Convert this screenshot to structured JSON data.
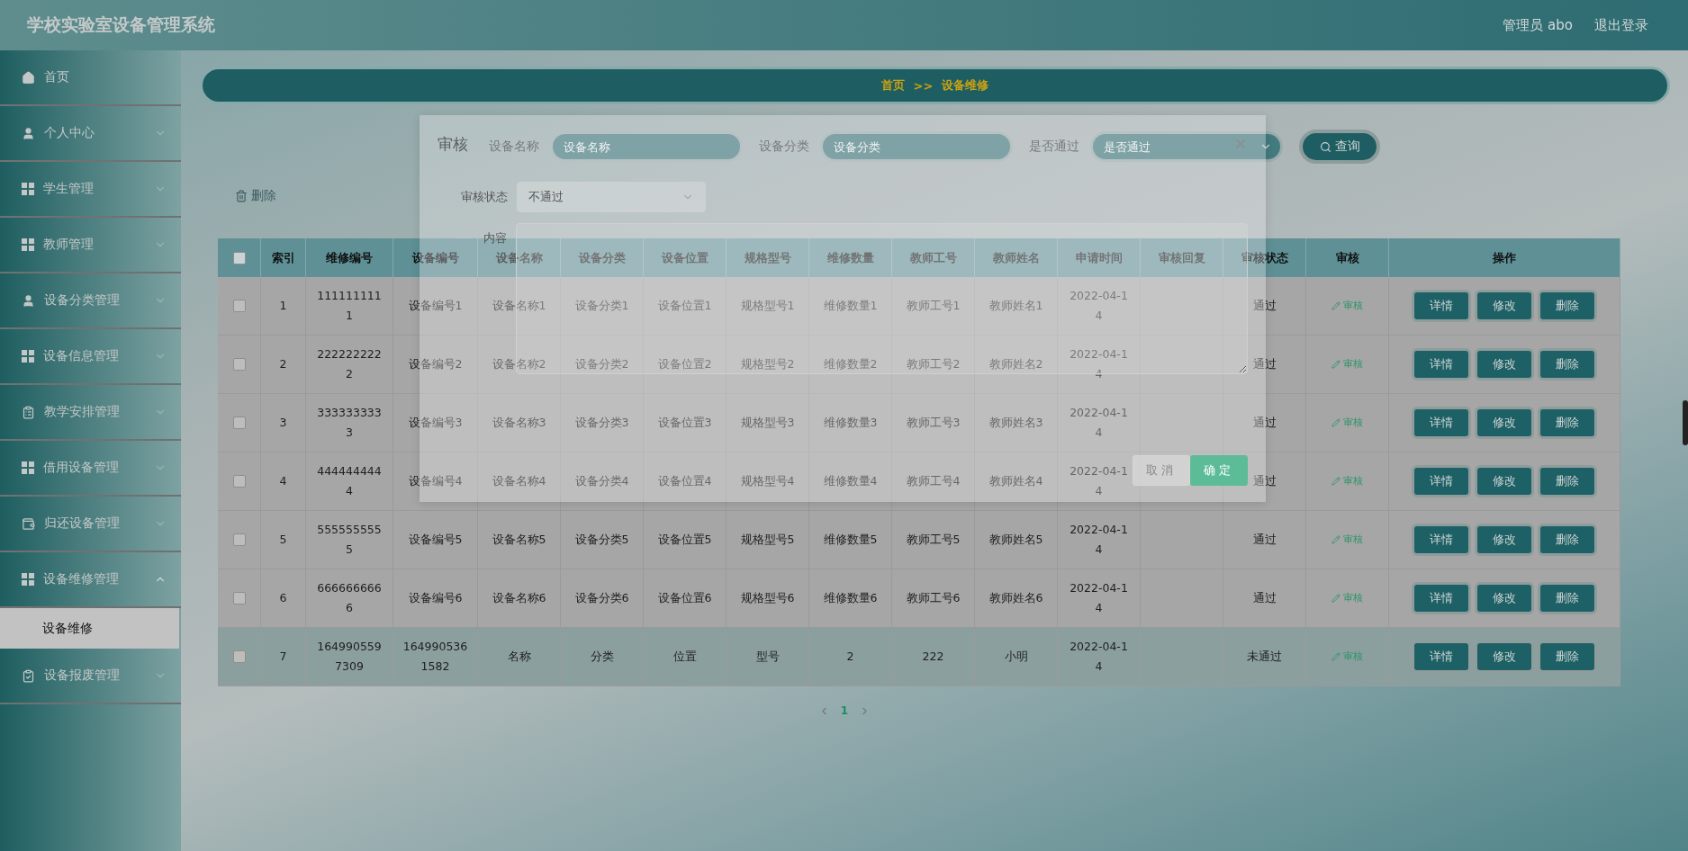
{
  "header": {
    "title": "学校实验室设备管理系统",
    "user": "管理员 abo",
    "logout": "退出登录"
  },
  "sidebar": {
    "items": [
      {
        "label": "首页",
        "kind": "home",
        "expanded": false
      },
      {
        "label": "个人中心",
        "kind": "user",
        "expanded": false
      },
      {
        "label": "学生管理",
        "kind": "grid",
        "expanded": false
      },
      {
        "label": "教师管理",
        "kind": "grid",
        "expanded": false
      },
      {
        "label": "设备分类管理",
        "kind": "user",
        "expanded": false
      },
      {
        "label": "设备信息管理",
        "kind": "grid",
        "expanded": false
      },
      {
        "label": "教学安排管理",
        "kind": "clipboard",
        "expanded": false
      },
      {
        "label": "借用设备管理",
        "kind": "grid",
        "expanded": false
      },
      {
        "label": "归还设备管理",
        "kind": "wallet",
        "expanded": false
      },
      {
        "label": "设备维修管理",
        "kind": "grid",
        "expanded": true,
        "children": [
          {
            "label": "设备维修",
            "selected": true
          }
        ]
      },
      {
        "label": "设备报废管理",
        "kind": "check",
        "expanded": false
      }
    ]
  },
  "breadcrumb": [
    "首页",
    ">>",
    "设备维修"
  ],
  "search": {
    "fields": [
      {
        "label": "设备名称",
        "kind": "input",
        "placeholder": "设备名称"
      },
      {
        "label": "设备分类",
        "kind": "input",
        "placeholder": "设备分类"
      },
      {
        "label": "是否通过",
        "kind": "select",
        "placeholder": "是否通过"
      }
    ],
    "button": "查询"
  },
  "toolbar": {
    "delete": "删除"
  },
  "table": {
    "select_all_checked": false,
    "columns": [
      "索引",
      "维修编号",
      "设备编号",
      "设备名称",
      "设备分类",
      "设备位置",
      "规格型号",
      "维修数量",
      "教师工号",
      "教师姓名",
      "申请时间",
      "审核回复",
      "审核状态",
      "审核",
      "操作"
    ],
    "rows": [
      {
        "checked": false,
        "highlighted": false,
        "index": "1",
        "repair_no": "1111111111",
        "device_no": "设备编号1",
        "name": "设备名称1",
        "category": "设备分类1",
        "location": "设备位置1",
        "model": "规格型号1",
        "quantity": "维修数量1",
        "teacher_no": "教师工号1",
        "teacher_name": "教师姓名1",
        "applied_at": "2022-04-14",
        "status": "通过",
        "audit": "审核",
        "actions": [
          "详情",
          "修改",
          "删除"
        ]
      },
      {
        "checked": false,
        "highlighted": false,
        "index": "2",
        "repair_no": "2222222222",
        "device_no": "设备编号2",
        "name": "设备名称2",
        "category": "设备分类2",
        "location": "设备位置2",
        "model": "规格型号2",
        "quantity": "维修数量2",
        "teacher_no": "教师工号2",
        "teacher_name": "教师姓名2",
        "applied_at": "2022-04-14",
        "status": "通过",
        "audit": "审核",
        "actions": [
          "详情",
          "修改",
          "删除"
        ]
      },
      {
        "checked": false,
        "highlighted": false,
        "index": "3",
        "repair_no": "3333333333",
        "device_no": "设备编号3",
        "name": "设备名称3",
        "category": "设备分类3",
        "location": "设备位置3",
        "model": "规格型号3",
        "quantity": "维修数量3",
        "teacher_no": "教师工号3",
        "teacher_name": "教师姓名3",
        "applied_at": "2022-04-14",
        "status": "通过",
        "audit": "审核",
        "actions": [
          "详情",
          "修改",
          "删除"
        ]
      },
      {
        "checked": false,
        "highlighted": false,
        "index": "4",
        "repair_no": "4444444444",
        "device_no": "设备编号4",
        "name": "设备名称4",
        "category": "设备分类4",
        "location": "设备位置4",
        "model": "规格型号4",
        "quantity": "维修数量4",
        "teacher_no": "教师工号4",
        "teacher_name": "教师姓名4",
        "applied_at": "2022-04-14",
        "status": "通过",
        "audit": "审核",
        "actions": [
          "详情",
          "修改",
          "删除"
        ]
      },
      {
        "checked": false,
        "highlighted": false,
        "index": "5",
        "repair_no": "5555555555",
        "device_no": "设备编号5",
        "name": "设备名称5",
        "category": "设备分类5",
        "location": "设备位置5",
        "model": "规格型号5",
        "quantity": "维修数量5",
        "teacher_no": "教师工号5",
        "teacher_name": "教师姓名5",
        "applied_at": "2022-04-14",
        "status": "通过",
        "audit": "审核",
        "actions": [
          "详情",
          "修改",
          "删除"
        ]
      },
      {
        "checked": false,
        "highlighted": false,
        "index": "6",
        "repair_no": "6666666666",
        "device_no": "设备编号6",
        "name": "设备名称6",
        "category": "设备分类6",
        "location": "设备位置6",
        "model": "规格型号6",
        "quantity": "维修数量6",
        "teacher_no": "教师工号6",
        "teacher_name": "教师姓名6",
        "applied_at": "2022-04-14",
        "status": "通过",
        "audit": "审核",
        "actions": [
          "详情",
          "修改",
          "删除"
        ]
      },
      {
        "checked": false,
        "highlighted": true,
        "index": "7",
        "repair_no": "1649905597309",
        "device_no": "1649905361582",
        "name": "名称",
        "category": "分类",
        "location": "位置",
        "model": "型号",
        "quantity": "2",
        "teacher_no": "222",
        "teacher_name": "小明",
        "applied_at": "2022-04-14",
        "status": "未通过",
        "audit": "审核",
        "actions": [
          "详情",
          "修改",
          "删除"
        ]
      }
    ]
  },
  "pagination": {
    "pages": [
      {
        "label": "1",
        "selected": true
      }
    ]
  },
  "dialog": {
    "title": "审核",
    "fields": [
      {
        "label": "审核状态",
        "kind": "select",
        "value": "不通过"
      },
      {
        "label": "内容",
        "kind": "textarea"
      }
    ],
    "buttons": [
      {
        "label": "取消",
        "kind": "secondary"
      },
      {
        "label": "确定",
        "kind": "primary"
      }
    ]
  }
}
